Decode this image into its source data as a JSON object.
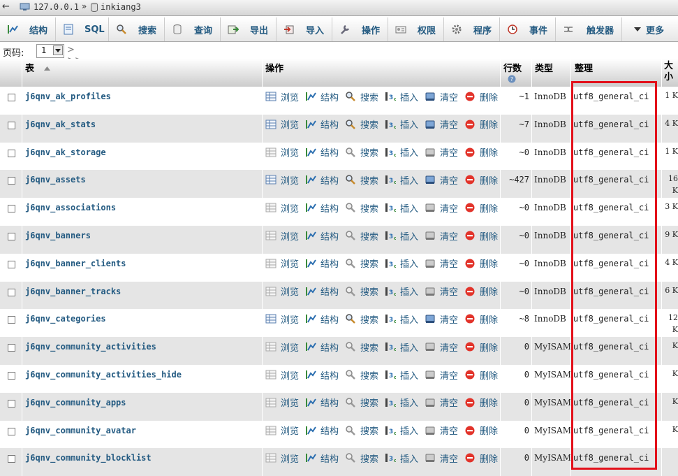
{
  "topbar": {
    "back": "←",
    "server": "127.0.0.1",
    "separator": "»",
    "database": "inkiang3"
  },
  "tabs": [
    {
      "label": "结构",
      "icon": "structure-icon"
    },
    {
      "label": "SQL",
      "icon": "sql-icon"
    },
    {
      "label": "搜索",
      "icon": "search-icon"
    },
    {
      "label": "查询",
      "icon": "query-icon"
    },
    {
      "label": "导出",
      "icon": "export-icon"
    },
    {
      "label": "导入",
      "icon": "import-icon"
    },
    {
      "label": "操作",
      "icon": "wrench-icon"
    },
    {
      "label": "权限",
      "icon": "privileges-icon"
    },
    {
      "label": "程序",
      "icon": "routines-icon"
    },
    {
      "label": "事件",
      "icon": "clock-icon"
    },
    {
      "label": "触发器",
      "icon": "triggers-icon"
    },
    {
      "label": "更多",
      "icon": "chevron-down-icon"
    }
  ],
  "pager": {
    "label": "页码:",
    "value": "1",
    "next": "> >>"
  },
  "headers": {
    "table": "表",
    "actions": "操作",
    "rows": "行数",
    "type": "类型",
    "collation": "整理",
    "size": "大小"
  },
  "action_labels": {
    "browse": "浏览",
    "structure": "结构",
    "search": "搜索",
    "insert": "插入",
    "empty": "清空",
    "drop": "删除"
  },
  "rows": [
    {
      "name": "j6qnv_ak_profiles",
      "rows": "~1",
      "type": "InnoDB",
      "collation": "utf8_general_ci",
      "size": "1 K",
      "has_data": true
    },
    {
      "name": "j6qnv_ak_stats",
      "rows": "~7",
      "type": "InnoDB",
      "collation": "utf8_general_ci",
      "size": "4 K",
      "has_data": true
    },
    {
      "name": "j6qnv_ak_storage",
      "rows": "~0",
      "type": "InnoDB",
      "collation": "utf8_general_ci",
      "size": "1 K",
      "has_data": false
    },
    {
      "name": "j6qnv_assets",
      "rows": "~427",
      "type": "InnoDB",
      "collation": "utf8_general_ci",
      "size": "16 K",
      "has_data": true
    },
    {
      "name": "j6qnv_associations",
      "rows": "~0",
      "type": "InnoDB",
      "collation": "utf8_general_ci",
      "size": "3 K",
      "has_data": false
    },
    {
      "name": "j6qnv_banners",
      "rows": "~0",
      "type": "InnoDB",
      "collation": "utf8_general_ci",
      "size": "9 K",
      "has_data": false
    },
    {
      "name": "j6qnv_banner_clients",
      "rows": "~0",
      "type": "InnoDB",
      "collation": "utf8_general_ci",
      "size": "4 K",
      "has_data": false
    },
    {
      "name": "j6qnv_banner_tracks",
      "rows": "~0",
      "type": "InnoDB",
      "collation": "utf8_general_ci",
      "size": "6 K",
      "has_data": false
    },
    {
      "name": "j6qnv_categories",
      "rows": "~8",
      "type": "InnoDB",
      "collation": "utf8_general_ci",
      "size": "12 K",
      "has_data": true
    },
    {
      "name": "j6qnv_community_activities",
      "rows": "0",
      "type": "MyISAM",
      "collation": "utf8_general_ci",
      "size": "K",
      "has_data": false
    },
    {
      "name": "j6qnv_community_activities_hide",
      "rows": "0",
      "type": "MyISAM",
      "collation": "utf8_general_ci",
      "size": "K",
      "has_data": false
    },
    {
      "name": "j6qnv_community_apps",
      "rows": "0",
      "type": "MyISAM",
      "collation": "utf8_general_ci",
      "size": "K",
      "has_data": false
    },
    {
      "name": "j6qnv_community_avatar",
      "rows": "0",
      "type": "MyISAM",
      "collation": "utf8_general_ci",
      "size": "K",
      "has_data": false
    },
    {
      "name": "j6qnv_community_blocklist",
      "rows": "0",
      "type": "MyISAM",
      "collation": "utf8_general_ci",
      "size": "",
      "has_data": false
    }
  ],
  "colors": {
    "link": "#235a81",
    "highlight_box": "#e3101a",
    "row_alt": "#e5e5e5"
  }
}
